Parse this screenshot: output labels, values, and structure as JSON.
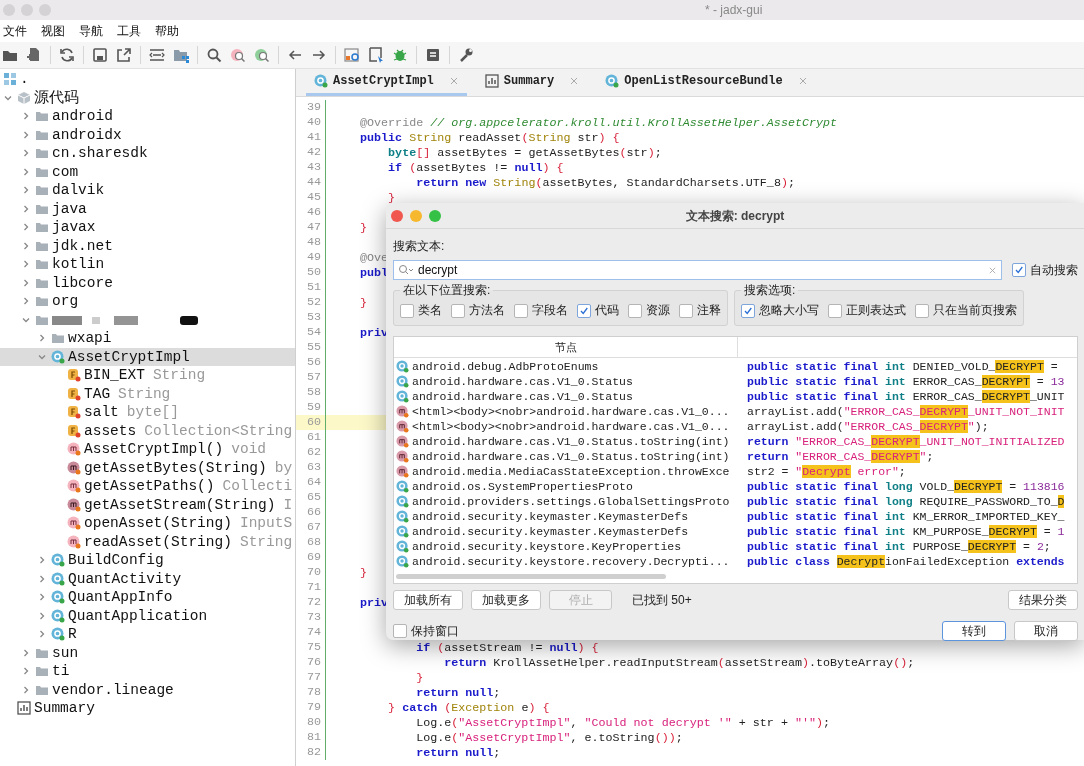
{
  "window": {
    "title": "* - jadx-gui"
  },
  "menu": [
    "文件",
    "视图",
    "导航",
    "工具",
    "帮助"
  ],
  "tree": {
    "label": ".",
    "children": [
      {
        "label": "源代码",
        "kind": "sources",
        "expanded": true,
        "selected": false,
        "children": [
          {
            "label": "android",
            "kind": "package",
            "expanded": false,
            "selected": false
          },
          {
            "label": "androidx",
            "kind": "package",
            "expanded": false,
            "selected": false
          },
          {
            "label": "cn.sharesdk",
            "kind": "package",
            "expanded": false,
            "selected": false
          },
          {
            "label": "com",
            "kind": "package",
            "expanded": false,
            "selected": false
          },
          {
            "label": "dalvik",
            "kind": "package",
            "expanded": false,
            "selected": false
          },
          {
            "label": "java",
            "kind": "package",
            "expanded": false,
            "selected": false
          },
          {
            "label": "javax",
            "kind": "package",
            "expanded": false,
            "selected": false
          },
          {
            "label": "jdk.net",
            "kind": "package",
            "expanded": false,
            "selected": false
          },
          {
            "label": "kotlin",
            "kind": "package",
            "expanded": false,
            "selected": false
          },
          {
            "label": "libcore",
            "kind": "package",
            "expanded": false,
            "selected": false
          },
          {
            "label": "org",
            "kind": "package",
            "expanded": false,
            "selected": false
          },
          {
            "kind": "redacted",
            "expanded": true,
            "selected": false,
            "children": [
              {
                "label": "wxapi",
                "kind": "package",
                "expanded": false,
                "selected": false
              },
              {
                "label": "AssetCryptImpl",
                "kind": "class",
                "expanded": true,
                "selected": true,
                "children": [
                  {
                    "label": "BIN_EXT",
                    "type": "String",
                    "kind": "field",
                    "selected": false
                  },
                  {
                    "label": "TAG",
                    "type": "String",
                    "kind": "field",
                    "selected": false
                  },
                  {
                    "label": "salt",
                    "type": "byte[]",
                    "kind": "field",
                    "selected": false
                  },
                  {
                    "label": "assets",
                    "type": "Collection<String",
                    "kind": "field",
                    "selected": false
                  },
                  {
                    "label": "AssetCryptImpl()",
                    "type": "void",
                    "kind": "method",
                    "selected": false
                  },
                  {
                    "label": "getAssetBytes(String)",
                    "type": "by",
                    "kind": "private-method",
                    "selected": false
                  },
                  {
                    "label": "getAssetPaths()",
                    "type": "Collecti",
                    "kind": "method",
                    "selected": false
                  },
                  {
                    "label": "getAssetStream(String)",
                    "type": "I",
                    "kind": "private-method",
                    "selected": false
                  },
                  {
                    "label": "openAsset(String)",
                    "type": "InputS",
                    "kind": "method",
                    "selected": false
                  },
                  {
                    "label": "readAsset(String)",
                    "type": "String",
                    "kind": "method",
                    "selected": false
                  }
                ]
              },
              {
                "label": "BuildConfig",
                "kind": "class",
                "expanded": false,
                "selected": false
              },
              {
                "label": "QuantActivity",
                "kind": "class",
                "expanded": false,
                "selected": false
              },
              {
                "label": "QuantAppInfo",
                "kind": "class",
                "expanded": false,
                "selected": false
              },
              {
                "label": "QuantApplication",
                "kind": "class",
                "expanded": false,
                "selected": false
              },
              {
                "label": "R",
                "kind": "class",
                "expanded": false,
                "selected": false
              }
            ]
          },
          {
            "label": "sun",
            "kind": "package",
            "expanded": false,
            "selected": false
          },
          {
            "label": "ti",
            "kind": "package",
            "expanded": false,
            "selected": false
          },
          {
            "label": "vendor.lineage",
            "kind": "package",
            "expanded": false,
            "selected": false
          }
        ]
      },
      {
        "label": "Summary",
        "kind": "summary",
        "selected": false
      }
    ]
  },
  "tabs": [
    {
      "label": "AssetCryptImpl",
      "kind": "class",
      "selected": true
    },
    {
      "label": "Summary",
      "kind": "summary",
      "selected": false
    },
    {
      "label": "OpenListResourceBundle",
      "kind": "class",
      "selected": false
    }
  ],
  "code": [
    {
      "number": "39",
      "highlighted": false
    },
    {
      "number": "40",
      "highlighted": false,
      "tokens": [
        {
          "kind": "annotation",
          "text": "    @Override "
        },
        {
          "kind": "comment",
          "text": "// org.appcelerator.kroll.util.KrollAssetHelper.AssetCrypt"
        }
      ]
    },
    {
      "number": "41",
      "highlighted": false,
      "tokens": [
        {
          "kind": "keyword",
          "text": "    public "
        },
        {
          "kind": "type",
          "text": "String"
        },
        {
          "kind": "plain",
          "text": " readAsset"
        },
        {
          "kind": "bracket",
          "text": "("
        },
        {
          "kind": "type",
          "text": "String"
        },
        {
          "kind": "plain",
          "text": " str"
        },
        {
          "kind": "bracket",
          "text": ") {"
        }
      ]
    },
    {
      "number": "42",
      "highlighted": false,
      "tokens": [
        {
          "kind": "primitive",
          "text": "        byte"
        },
        {
          "kind": "bracket",
          "text": "[]"
        },
        {
          "kind": "plain",
          "text": " assetBytes = getAssetBytes"
        },
        {
          "kind": "bracket",
          "text": "("
        },
        {
          "kind": "plain",
          "text": "str"
        },
        {
          "kind": "bracket",
          "text": ")"
        },
        {
          "kind": "plain",
          "text": ";"
        }
      ]
    },
    {
      "number": "43",
      "highlighted": false,
      "tokens": [
        {
          "kind": "keyword",
          "text": "        if "
        },
        {
          "kind": "bracket",
          "text": "("
        },
        {
          "kind": "plain",
          "text": "assetBytes != "
        },
        {
          "kind": "keyword",
          "text": "null"
        },
        {
          "kind": "bracket",
          "text": ") {"
        }
      ]
    },
    {
      "number": "44",
      "highlighted": false,
      "tokens": [
        {
          "kind": "keyword",
          "text": "            return new "
        },
        {
          "kind": "type",
          "text": "String"
        },
        {
          "kind": "bracket",
          "text": "("
        },
        {
          "kind": "plain",
          "text": "assetBytes, StandardCharsets.UTF_8"
        },
        {
          "kind": "bracket",
          "text": ")"
        },
        {
          "kind": "plain",
          "text": ";"
        }
      ]
    },
    {
      "number": "45",
      "highlighted": false,
      "tokens": [
        {
          "kind": "bracket",
          "text": "        }"
        }
      ]
    },
    {
      "number": "46",
      "highlighted": false
    },
    {
      "number": "47",
      "highlighted": false,
      "tokens": [
        {
          "kind": "bracket",
          "text": "    }"
        }
      ]
    },
    {
      "number": "48",
      "highlighted": false
    },
    {
      "number": "49",
      "highlighted": false,
      "tokens": [
        {
          "kind": "annotation",
          "text": "    @Ove"
        }
      ]
    },
    {
      "number": "50",
      "highlighted": false,
      "tokens": [
        {
          "kind": "keyword",
          "text": "    publ"
        }
      ]
    },
    {
      "number": "51",
      "highlighted": false
    },
    {
      "number": "52",
      "highlighted": false,
      "tokens": [
        {
          "kind": "bracket",
          "text": "    }"
        }
      ]
    },
    {
      "number": "53",
      "highlighted": false
    },
    {
      "number": "54",
      "highlighted": false,
      "tokens": [
        {
          "kind": "keyword",
          "text": "    priv"
        }
      ]
    },
    {
      "number": "55",
      "highlighted": false
    },
    {
      "number": "56",
      "highlighted": false
    },
    {
      "number": "57",
      "highlighted": false
    },
    {
      "number": "58",
      "highlighted": false
    },
    {
      "number": "59",
      "highlighted": false
    },
    {
      "number": "60",
      "highlighted": true
    },
    {
      "number": "61",
      "highlighted": false
    },
    {
      "number": "62",
      "highlighted": false
    },
    {
      "number": "63",
      "highlighted": false
    },
    {
      "number": "64",
      "highlighted": false
    },
    {
      "number": "65",
      "highlighted": false
    },
    {
      "number": "66",
      "highlighted": false
    },
    {
      "number": "67",
      "highlighted": false
    },
    {
      "number": "68",
      "highlighted": false
    },
    {
      "number": "69",
      "highlighted": false
    },
    {
      "number": "70",
      "highlighted": false,
      "tokens": [
        {
          "kind": "bracket",
          "text": "    }"
        }
      ]
    },
    {
      "number": "71",
      "highlighted": false
    },
    {
      "number": "72",
      "highlighted": false,
      "tokens": [
        {
          "kind": "keyword",
          "text": "    priv"
        }
      ]
    },
    {
      "number": "73",
      "highlighted": false
    },
    {
      "number": "74",
      "highlighted": false
    },
    {
      "number": "75",
      "highlighted": false,
      "tokens": [
        {
          "kind": "keyword",
          "text": "            if "
        },
        {
          "kind": "bracket",
          "text": "("
        },
        {
          "kind": "plain",
          "text": "assetStream != "
        },
        {
          "kind": "keyword",
          "text": "null"
        },
        {
          "kind": "bracket",
          "text": ") {"
        }
      ]
    },
    {
      "number": "76",
      "highlighted": false,
      "tokens": [
        {
          "kind": "keyword",
          "text": "                return "
        },
        {
          "kind": "plain",
          "text": "KrollAssetHelper.readInputStream"
        },
        {
          "kind": "bracket",
          "text": "("
        },
        {
          "kind": "plain",
          "text": "assetStream"
        },
        {
          "kind": "bracket",
          "text": ")"
        },
        {
          "kind": "plain",
          "text": ".toByteArray"
        },
        {
          "kind": "bracket",
          "text": "()"
        },
        {
          "kind": "plain",
          "text": ";"
        }
      ]
    },
    {
      "number": "77",
      "highlighted": false,
      "tokens": [
        {
          "kind": "bracket",
          "text": "            }"
        }
      ]
    },
    {
      "number": "78",
      "highlighted": false,
      "tokens": [
        {
          "kind": "keyword",
          "text": "            return null"
        },
        {
          "kind": "plain",
          "text": ";"
        }
      ]
    },
    {
      "number": "79",
      "highlighted": false,
      "tokens": [
        {
          "kind": "bracket",
          "text": "        }"
        },
        {
          "kind": "keyword",
          "text": " catch "
        },
        {
          "kind": "bracket",
          "text": "("
        },
        {
          "kind": "type",
          "text": "Exception"
        },
        {
          "kind": "plain",
          "text": " e"
        },
        {
          "kind": "bracket",
          "text": ") {"
        }
      ]
    },
    {
      "number": "80",
      "highlighted": false,
      "tokens": [
        {
          "kind": "plain",
          "text": "            Log.e"
        },
        {
          "kind": "bracket",
          "text": "("
        },
        {
          "kind": "string",
          "text": "\"AssetCryptImpl\""
        },
        {
          "kind": "plain",
          "text": ", "
        },
        {
          "kind": "string",
          "text": "\"Could not decrypt '\""
        },
        {
          "kind": "plain",
          "text": " + str + "
        },
        {
          "kind": "string",
          "text": "\"'\""
        },
        {
          "kind": "bracket",
          "text": ")"
        },
        {
          "kind": "plain",
          "text": ";"
        }
      ]
    },
    {
      "number": "81",
      "highlighted": false,
      "tokens": [
        {
          "kind": "plain",
          "text": "            Log.e"
        },
        {
          "kind": "bracket",
          "text": "("
        },
        {
          "kind": "string",
          "text": "\"AssetCryptImpl\""
        },
        {
          "kind": "plain",
          "text": ", e.toString"
        },
        {
          "kind": "bracket",
          "text": "())"
        },
        {
          "kind": "plain",
          "text": ";"
        }
      ]
    },
    {
      "number": "82",
      "highlighted": false,
      "tokens": [
        {
          "kind": "keyword",
          "text": "            return null"
        },
        {
          "kind": "plain",
          "text": ";"
        }
      ]
    }
  ],
  "dialog": {
    "title": "文本搜索: decrypt",
    "search_label": "搜索文本:",
    "search_value": "decrypt",
    "auto_search": {
      "label": "自动搜索",
      "checked": true
    },
    "scope": {
      "title": "在以下位置搜索:",
      "options": [
        {
          "label": "类名",
          "checked": false
        },
        {
          "label": "方法名",
          "checked": false
        },
        {
          "label": "字段名",
          "checked": false
        },
        {
          "label": "代码",
          "checked": true
        },
        {
          "label": "资源",
          "checked": false
        },
        {
          "label": "注释",
          "checked": false
        }
      ]
    },
    "options": {
      "title": "搜索选项:",
      "options": [
        {
          "label": "忽略大小写",
          "checked": true
        },
        {
          "label": "正则表达式",
          "checked": false
        },
        {
          "label": "只在当前页搜索",
          "checked": false
        }
      ]
    },
    "table": {
      "columns": [
        "节点"
      ],
      "rows": [
        {
          "kind": "class",
          "selected": false,
          "node": "android.debug.AdbProtoEnums",
          "code": [
            {
              "kind": "keyword",
              "text": "public static final "
            },
            {
              "kind": "primitive",
              "text": "int "
            },
            {
              "kind": "plain",
              "text": "DENIED_VOLD_"
            },
            {
              "kind": "match",
              "text": "DECRYPT"
            },
            {
              "kind": "plain",
              "text": " ="
            }
          ]
        },
        {
          "kind": "class",
          "selected": false,
          "node": "android.hardware.cas.V1_0.Status",
          "code": [
            {
              "kind": "keyword",
              "text": "public static final "
            },
            {
              "kind": "primitive",
              "text": "int "
            },
            {
              "kind": "plain",
              "text": "ERROR_CAS_"
            },
            {
              "kind": "match",
              "text": "DECRYPT"
            },
            {
              "kind": "plain",
              "text": " = "
            },
            {
              "kind": "number",
              "text": "13"
            }
          ]
        },
        {
          "kind": "class",
          "selected": false,
          "node": "android.hardware.cas.V1_0.Status",
          "code": [
            {
              "kind": "keyword",
              "text": "public static final "
            },
            {
              "kind": "primitive",
              "text": "int "
            },
            {
              "kind": "plain",
              "text": "ERROR_CAS_"
            },
            {
              "kind": "match",
              "text": "DECRYPT"
            },
            {
              "kind": "plain",
              "text": "_UNIT"
            }
          ]
        },
        {
          "kind": "method",
          "selected": false,
          "node": "<html><body><nobr>android.hardware.cas.V1_0...",
          "code": [
            {
              "kind": "plain",
              "text": "arrayList.add("
            },
            {
              "kind": "string",
              "text": "\"ERROR_CAS_"
            },
            {
              "kind": "string-match",
              "text": "DECRYPT"
            },
            {
              "kind": "string",
              "text": "_UNIT_NOT_INIT"
            }
          ]
        },
        {
          "kind": "method",
          "selected": false,
          "node": "<html><body><nobr>android.hardware.cas.V1_0...",
          "code": [
            {
              "kind": "plain",
              "text": "arrayList.add("
            },
            {
              "kind": "string",
              "text": "\"ERROR_CAS_"
            },
            {
              "kind": "string-match",
              "text": "DECRYPT"
            },
            {
              "kind": "string",
              "text": "\""
            },
            {
              "kind": "plain",
              "text": ");"
            }
          ]
        },
        {
          "kind": "method",
          "selected": false,
          "node": "android.hardware.cas.V1_0.Status.toString(int)",
          "code": [
            {
              "kind": "keyword",
              "text": "return "
            },
            {
              "kind": "string",
              "text": "\"ERROR_CAS_"
            },
            {
              "kind": "string-match",
              "text": "DECRYPT"
            },
            {
              "kind": "string",
              "text": "_UNIT_NOT_INITIALIZED"
            }
          ]
        },
        {
          "kind": "method",
          "selected": false,
          "node": "android.hardware.cas.V1_0.Status.toString(int)",
          "code": [
            {
              "kind": "keyword",
              "text": "return "
            },
            {
              "kind": "string",
              "text": "\"ERROR_CAS_"
            },
            {
              "kind": "string-match",
              "text": "DECRYPT"
            },
            {
              "kind": "string",
              "text": "\""
            },
            {
              "kind": "plain",
              "text": ";"
            }
          ]
        },
        {
          "kind": "method",
          "selected": false,
          "node": "android.media.MediaCasStateException.throwExce",
          "code": [
            {
              "kind": "plain",
              "text": "str2 = "
            },
            {
              "kind": "string",
              "text": "\""
            },
            {
              "kind": "string-match",
              "text": "Decrypt"
            },
            {
              "kind": "string",
              "text": " error\""
            },
            {
              "kind": "plain",
              "text": ";"
            }
          ]
        },
        {
          "kind": "class",
          "selected": false,
          "node": "android.os.SystemPropertiesProto",
          "code": [
            {
              "kind": "keyword",
              "text": "public static final "
            },
            {
              "kind": "primitive",
              "text": "long "
            },
            {
              "kind": "plain",
              "text": "VOLD_"
            },
            {
              "kind": "match",
              "text": "DECRYPT"
            },
            {
              "kind": "plain",
              "text": " = "
            },
            {
              "kind": "number",
              "text": "113816"
            }
          ]
        },
        {
          "kind": "class",
          "selected": false,
          "node": "android.providers.settings.GlobalSettingsProto",
          "code": [
            {
              "kind": "keyword",
              "text": "public static final "
            },
            {
              "kind": "primitive",
              "text": "long "
            },
            {
              "kind": "plain",
              "text": "REQUIRE_PASSWORD_TO_"
            },
            {
              "kind": "match",
              "text": "D"
            }
          ]
        },
        {
          "kind": "class",
          "selected": false,
          "node": "android.security.keymaster.KeymasterDefs",
          "code": [
            {
              "kind": "keyword",
              "text": "public static final "
            },
            {
              "kind": "primitive",
              "text": "int "
            },
            {
              "kind": "plain",
              "text": "KM_ERROR_IMPORTED_KEY_"
            }
          ]
        },
        {
          "kind": "class",
          "selected": false,
          "node": "android.security.keymaster.KeymasterDefs",
          "code": [
            {
              "kind": "keyword",
              "text": "public static final "
            },
            {
              "kind": "primitive",
              "text": "int "
            },
            {
              "kind": "plain",
              "text": "KM_PURPOSE_"
            },
            {
              "kind": "match",
              "text": "DECRYPT"
            },
            {
              "kind": "plain",
              "text": " = "
            },
            {
              "kind": "number",
              "text": "1"
            }
          ]
        },
        {
          "kind": "class",
          "selected": false,
          "node": "android.security.keystore.KeyProperties",
          "code": [
            {
              "kind": "keyword",
              "text": "public static final "
            },
            {
              "kind": "primitive",
              "text": "int "
            },
            {
              "kind": "plain",
              "text": "PURPOSE_"
            },
            {
              "kind": "match",
              "text": "DECRYPT"
            },
            {
              "kind": "plain",
              "text": " = "
            },
            {
              "kind": "number",
              "text": "2"
            },
            {
              "kind": "plain",
              "text": ";"
            }
          ]
        },
        {
          "kind": "class",
          "selected": false,
          "node": "android.security.keystore.recovery.Decrypti...",
          "code": [
            {
              "kind": "keyword",
              "text": "public class "
            },
            {
              "kind": "match",
              "text": "Decrypt"
            },
            {
              "kind": "plain",
              "text": "ionFailedException "
            },
            {
              "kind": "keyword",
              "text": "extends"
            }
          ]
        }
      ]
    },
    "actions": [
      {
        "label": "加载所有",
        "disabled": false
      },
      {
        "label": "加载更多",
        "disabled": false
      },
      {
        "label": "停止",
        "disabled": true
      }
    ],
    "status": "已找到 50+",
    "group_button": "结果分类",
    "keep_open": {
      "label": "保持窗口",
      "checked": false
    },
    "buttons": [
      {
        "label": "转到",
        "default": true
      },
      {
        "label": "取消",
        "default": false
      }
    ]
  }
}
